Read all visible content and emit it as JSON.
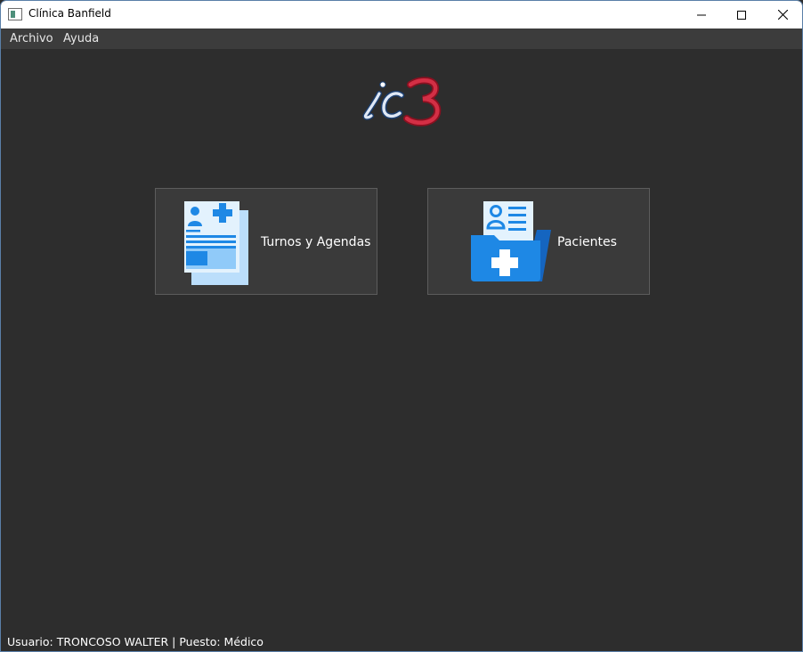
{
  "window": {
    "title": "Clínica Banfield",
    "controls": [
      "minimize",
      "maximize",
      "close"
    ]
  },
  "menu": {
    "items": [
      {
        "label": "Archivo"
      },
      {
        "label": "Ayuda"
      }
    ]
  },
  "logo": {
    "text": "ic3",
    "colors": {
      "ic": "#3a6fb5",
      "three": "#c8253a"
    }
  },
  "main": {
    "buttons": [
      {
        "label": "Turnos y Agendas",
        "icon": "medical-record-icon"
      },
      {
        "label": "Pacientes",
        "icon": "patient-folder-icon"
      }
    ]
  },
  "status_bar": {
    "text": "Usuario: TRONCOSO WALTER | Puesto: Médico"
  },
  "colors": {
    "background": "#2d2d2d",
    "menubar": "#3c3c3c",
    "button_bg": "#3a3a3a",
    "button_border": "#5c5c5c",
    "icon_blue": "#1e88e5",
    "icon_light_blue": "#bbdefb"
  }
}
